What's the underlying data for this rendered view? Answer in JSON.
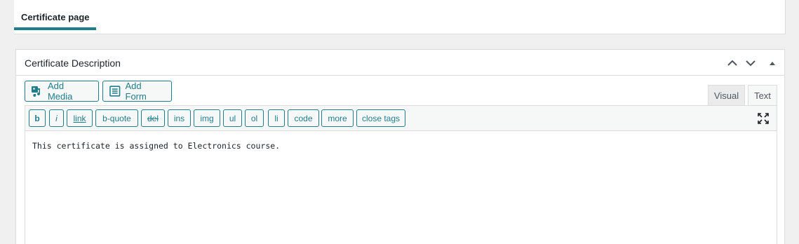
{
  "tabs": {
    "certificate_page": "Certificate page"
  },
  "postbox": {
    "title": "Certificate Description",
    "controls": [
      "move-up",
      "move-down",
      "toggle-panel"
    ]
  },
  "media_buttons": {
    "add_media": "Add Media",
    "add_form": "Add Form"
  },
  "editor_tabs": {
    "visual": "Visual",
    "text": "Text"
  },
  "quicktags": [
    "b",
    "i",
    "link",
    "b-quote",
    "del",
    "ins",
    "img",
    "ul",
    "ol",
    "li",
    "code",
    "more",
    "close tags"
  ],
  "editor": {
    "content": "This certificate is assigned to Electronics course."
  },
  "colors": {
    "accent": "#1e7e8c",
    "background": "#f0f0f1",
    "panel": "#ffffff",
    "border": "#dcdcde"
  },
  "icons": [
    "add-media-icon",
    "add-form-icon",
    "chevron-up-icon",
    "chevron-down-icon",
    "triangle-up-icon",
    "fullscreen-icon"
  ]
}
